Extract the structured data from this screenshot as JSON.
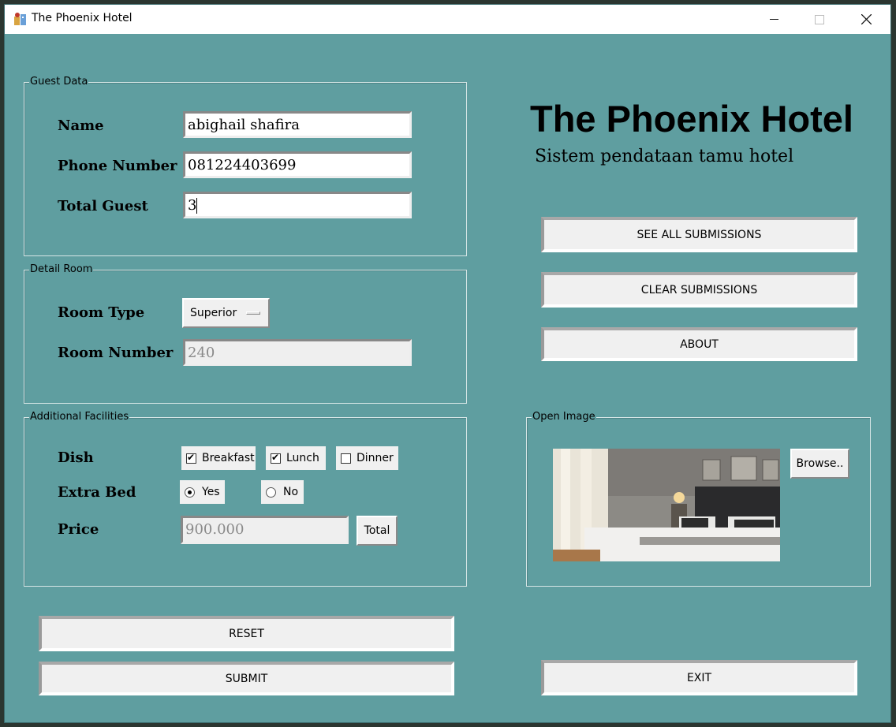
{
  "window": {
    "title": "The Phoenix Hotel"
  },
  "header": {
    "title": "The Phoenix Hotel",
    "subtitle": "Sistem pendataan tamu hotel"
  },
  "guest_data": {
    "legend": "Guest Data",
    "name_label": "Name",
    "name_value": "abighail shafira",
    "phone_label": "Phone Number",
    "phone_value": "081224403699",
    "total_label": "Total Guest",
    "total_value": "3"
  },
  "detail_room": {
    "legend": "Detail Room",
    "type_label": "Room Type",
    "type_value": "Superior",
    "number_label": "Room Number",
    "number_value": "240"
  },
  "facilities": {
    "legend": "Additional Facilities",
    "dish_label": "Dish",
    "dishes": [
      {
        "label": "Breakfast",
        "checked": true
      },
      {
        "label": "Lunch",
        "checked": true
      },
      {
        "label": "Dinner",
        "checked": false
      }
    ],
    "extra_bed_label": "Extra Bed",
    "extra_bed_options": [
      {
        "label": "Yes",
        "selected": true
      },
      {
        "label": "No",
        "selected": false
      }
    ],
    "price_label": "Price",
    "price_value": "900.000",
    "total_button": "Total"
  },
  "actions": {
    "see_all": "SEE ALL SUBMISSIONS",
    "clear": "CLEAR SUBMISSIONS",
    "about": "ABOUT",
    "reset": "RESET",
    "submit": "SUBMIT",
    "exit": "EXIT"
  },
  "open_image": {
    "legend": "Open Image",
    "browse_button": "Browse.."
  },
  "colors": {
    "background": "#5f9ea0",
    "button": "#f0f0f0"
  }
}
